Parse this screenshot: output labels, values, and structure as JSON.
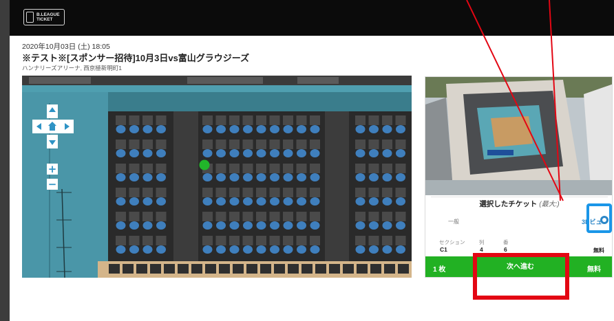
{
  "brand": {
    "logo_text_line1": "B.LEAGUE",
    "logo_text_line2": "TICKET"
  },
  "event": {
    "datetime": "2020年10月03日 (土) 18:05",
    "title": "※テスト※[スポンサー招待]10月3日vs富山グラウジーズ",
    "venue": "ハンナリーズアリーナ, 西京極新明町1"
  },
  "map": {
    "controls": {
      "zoom_in": "+",
      "zoom_out": "−"
    },
    "selected_seat_color": "#21b52a",
    "seat_color": "#3f7fbd",
    "court_color": "#3a7d8c"
  },
  "panel": {
    "heading": "選択したチケット",
    "heading_suffix": "(最大:",
    "heading_suffix_tail": ")",
    "ticket_type": "一般",
    "view3d_label": "3Dビュー",
    "seat_headers": {
      "section": "セクション",
      "row": "列",
      "number": "番"
    },
    "seat_values": {
      "section": "C1",
      "row": "4",
      "number": "6"
    },
    "price": "無料",
    "footer": {
      "quantity": "1 枚",
      "next_button": "次へ進む",
      "total": "無料"
    }
  },
  "colors": {
    "accent_green": "#22b123",
    "link_blue": "#2b86c7",
    "annotation_red": "#e30613",
    "annotation_blue": "#1a96e8"
  }
}
